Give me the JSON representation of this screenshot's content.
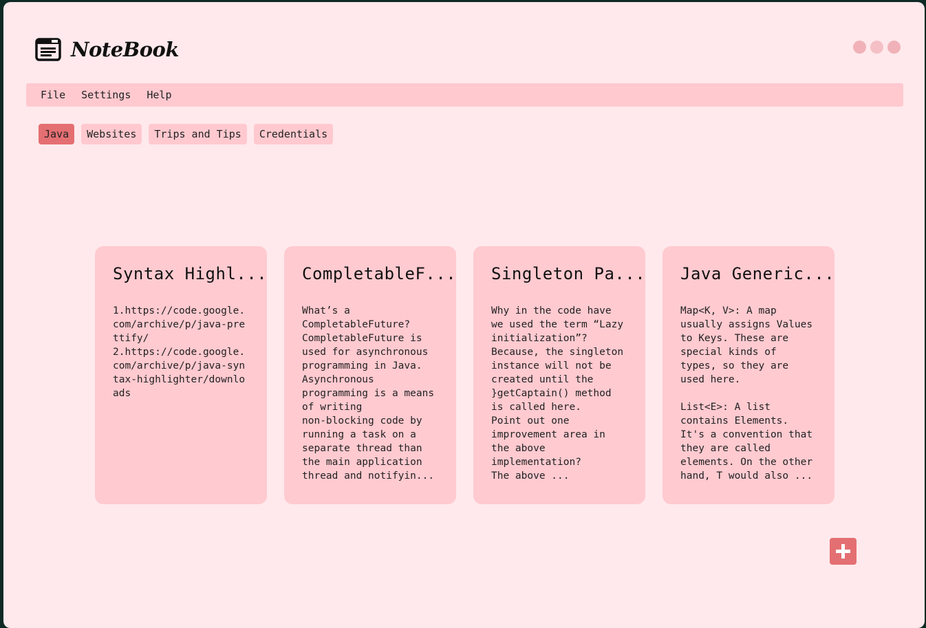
{
  "app": {
    "title": "NoteBook"
  },
  "window_controls": [
    {
      "name": "minimize",
      "color": "#f0b2b8"
    },
    {
      "name": "maximize",
      "color": "#f4c0c6"
    },
    {
      "name": "close",
      "color": "#f0b2b8"
    }
  ],
  "menu": {
    "file": "File",
    "settings": "Settings",
    "help": "Help"
  },
  "tabs": [
    {
      "label": "Java",
      "active": true
    },
    {
      "label": "Websites",
      "active": false
    },
    {
      "label": "Trips and Tips",
      "active": false
    },
    {
      "label": "Credentials",
      "active": false
    }
  ],
  "notes": [
    {
      "title": "Syntax Highl...",
      "body": "1.https://code.google.com/archive/p/java-prettify/\n2.https://code.google.com/archive/p/java-syntax-highlighter/downloads"
    },
    {
      "title": "CompletableF...",
      "body": "What’s a\nCompletableFuture?\nCompletableFuture is\nused for asynchronous\nprogramming in Java.\nAsynchronous\nprogramming is a means\nof writing\nnon-blocking code by\nrunning a task on a\nseparate thread than\nthe main application\nthread and notifyin..."
    },
    {
      "title": "Singleton Pa...",
      "body": "Why in the code have\nwe used the term “Lazy\ninitialization”?\nBecause, the singleton\ninstance will not be\ncreated until the\n}getCaptain() method\nis called here.\nPoint out one\nimprovement area in\nthe above\nimplementation?\nThe above ..."
    },
    {
      "title": "Java Generic...",
      "body": "Map<K, V>: A map\nusually assigns Values\nto Keys. These are\nspecial kinds of\ntypes, so they are\nused here.\n\nList<E>: A list\ncontains Elements.\nIt's a convention that\nthey are called\nelements. On the other\nhand, T would also ..."
    }
  ],
  "add_button": {
    "icon": "plus-icon"
  },
  "colors": {
    "background": "#ffe9ec",
    "menubar": "#ffc9cf",
    "card": "#ffcad0",
    "accent": "#e46f72"
  }
}
